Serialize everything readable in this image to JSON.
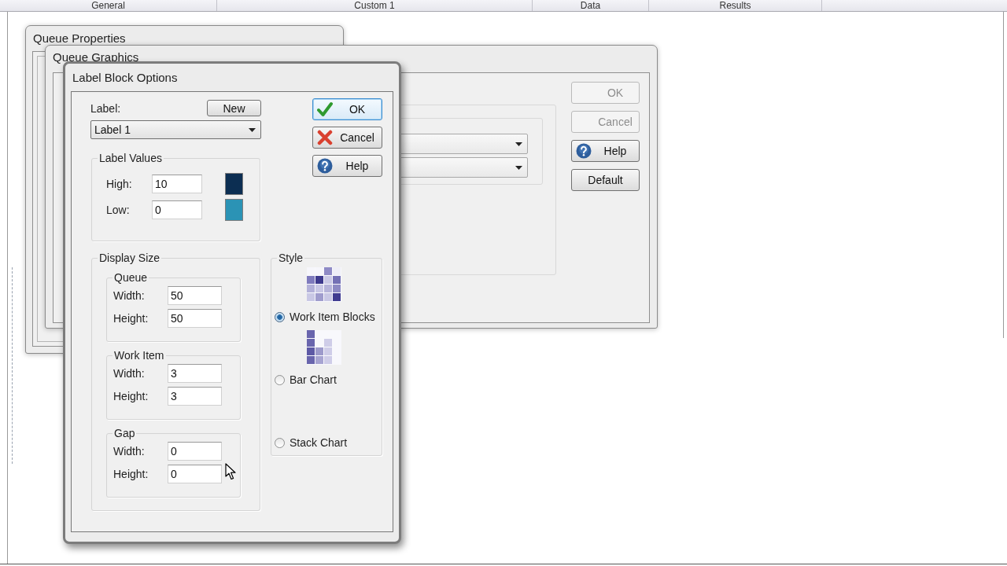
{
  "header": {
    "columns": [
      {
        "label": "General"
      },
      {
        "label": "Custom 1"
      },
      {
        "label": "Data"
      },
      {
        "label": "Results"
      }
    ]
  },
  "queue_properties": {
    "title": "Queue Properties"
  },
  "queue_graphics": {
    "title": "Queue Graphics",
    "buttons": [
      {
        "label": "OK",
        "kind": "ok",
        "disabled": true
      },
      {
        "label": "Cancel",
        "kind": "cancel",
        "disabled": true
      },
      {
        "label": "Help",
        "kind": "help",
        "disabled": false
      },
      {
        "label": "Default",
        "kind": "default",
        "disabled": false
      }
    ]
  },
  "label_block_options": {
    "title": "Label Block Options",
    "label_caption": "Label:",
    "new_button": "New",
    "label_select": {
      "value": "Label 1"
    },
    "buttons": [
      {
        "label": "OK",
        "kind": "ok",
        "focused": true
      },
      {
        "label": "Cancel",
        "kind": "cancel",
        "focused": false
      },
      {
        "label": "Help",
        "kind": "help",
        "focused": false
      }
    ],
    "label_values": {
      "title": "Label Values",
      "rows": [
        {
          "label": "High:",
          "value": "10",
          "color": "#0c2e52"
        },
        {
          "label": "Low:",
          "value": "0",
          "color": "#2b93b5"
        }
      ]
    },
    "display_size": {
      "title": "Display Size",
      "groups": [
        {
          "title": "Queue",
          "fields": [
            {
              "label": "Width:",
              "value": "50"
            },
            {
              "label": "Height:",
              "value": "50"
            }
          ]
        },
        {
          "title": "Work Item",
          "fields": [
            {
              "label": "Width:",
              "value": "3"
            },
            {
              "label": "Height:",
              "value": "3"
            }
          ]
        },
        {
          "title": "Gap",
          "fields": [
            {
              "label": "Width:",
              "value": "0"
            },
            {
              "label": "Height:",
              "value": "0"
            }
          ]
        }
      ]
    },
    "style": {
      "title": "Style",
      "options": [
        {
          "label": "Work Item Blocks",
          "kind": "blocks",
          "selected": true
        },
        {
          "label": "Bar Chart",
          "kind": "bar",
          "selected": false
        },
        {
          "label": "Stack Chart",
          "kind": "stack",
          "selected": false
        }
      ]
    }
  }
}
